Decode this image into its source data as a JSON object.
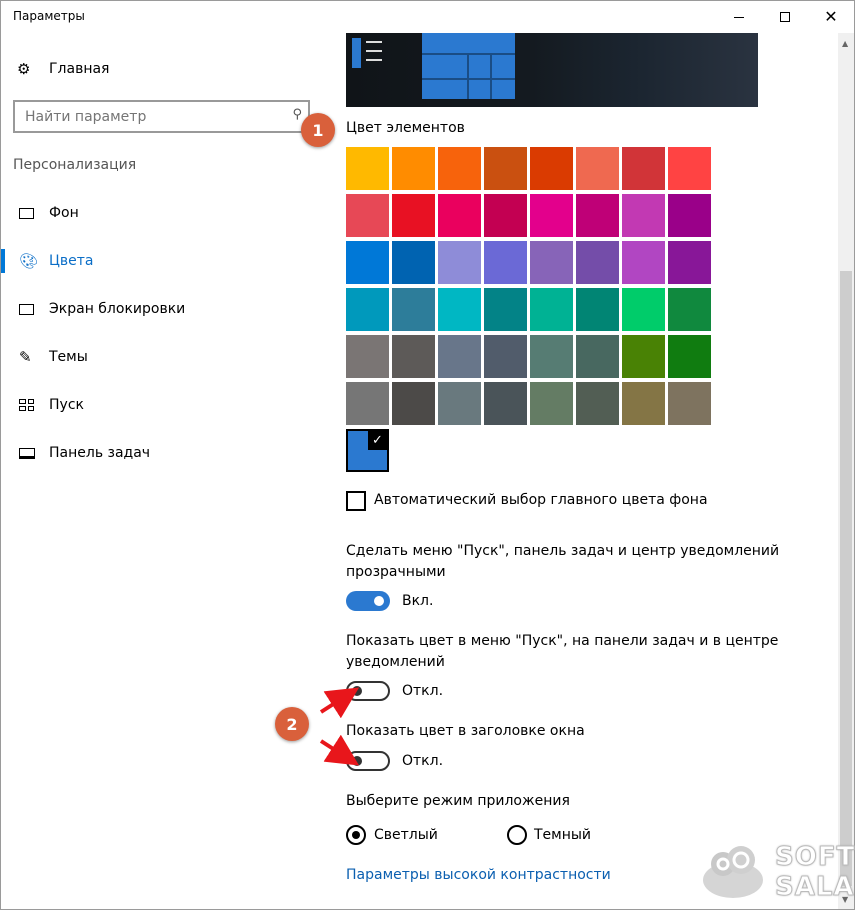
{
  "window": {
    "title": "Параметры"
  },
  "sidebar": {
    "home": "Главная",
    "search_placeholder": "Найти параметр",
    "section": "Персонализация",
    "items": [
      {
        "label": "Фон",
        "icon": "image-icon",
        "active": false
      },
      {
        "label": "Цвета",
        "icon": "palette-icon",
        "active": true
      },
      {
        "label": "Экран блокировки",
        "icon": "lock-screen-icon",
        "active": false
      },
      {
        "label": "Темы",
        "icon": "themes-icon",
        "active": false
      },
      {
        "label": "Пуск",
        "icon": "start-icon",
        "active": false
      },
      {
        "label": "Панель задач",
        "icon": "taskbar-icon",
        "active": false
      }
    ]
  },
  "content": {
    "accent_heading": "Цвет элементов",
    "accent_colors": [
      [
        "#FFB900",
        "#FF8C00",
        "#F7630C",
        "#CA5010",
        "#DA3B01",
        "#EF6950",
        "#D13438",
        "#FF4343"
      ],
      [
        "#E74856",
        "#E81123",
        "#EA005E",
        "#C30052",
        "#E3008C",
        "#BF0077",
        "#C239B3",
        "#9A0089"
      ],
      [
        "#0078D7",
        "#0063B1",
        "#8E8CD8",
        "#6B69D6",
        "#8764B8",
        "#744DA9",
        "#B146C2",
        "#881798"
      ],
      [
        "#0099BC",
        "#2D7D9A",
        "#00B7C3",
        "#038387",
        "#00B294",
        "#018574",
        "#00CC6A",
        "#10893E"
      ],
      [
        "#7A7574",
        "#5D5A58",
        "#68768A",
        "#515C6B",
        "#567C73",
        "#486860",
        "#498205",
        "#107C10"
      ],
      [
        "#767676",
        "#4C4A48",
        "#69797E",
        "#4A5459",
        "#647C64",
        "#525E54",
        "#847545",
        "#7E735F"
      ]
    ],
    "selected_color": "#2B79D0",
    "auto_color_label": "Автоматический выбор главного цвета фона",
    "auto_color_checked": false,
    "transparency_label_1": "Сделать меню \"Пуск\", панель задач и центр уведомлений",
    "transparency_label_2": "прозрачными",
    "transparency_state": "Вкл.",
    "show_color_start_label_1": "Показать цвет в меню \"Пуск\", на панели задач и в центре",
    "show_color_start_label_2": "уведомлений",
    "show_color_start_state": "Откл.",
    "show_color_title_label": "Показать цвет в заголовке окна",
    "show_color_title_state": "Откл.",
    "app_mode_label": "Выберите режим приложения",
    "mode_light": "Светлый",
    "mode_dark": "Темный",
    "mode_selected": "light",
    "high_contrast_link": "Параметры высокой контрастности"
  },
  "annotations": {
    "badge_1": "1",
    "badge_2": "2",
    "color": "#D9603B"
  },
  "watermark": {
    "line1": "SOFT",
    "line2": "SALAD"
  }
}
